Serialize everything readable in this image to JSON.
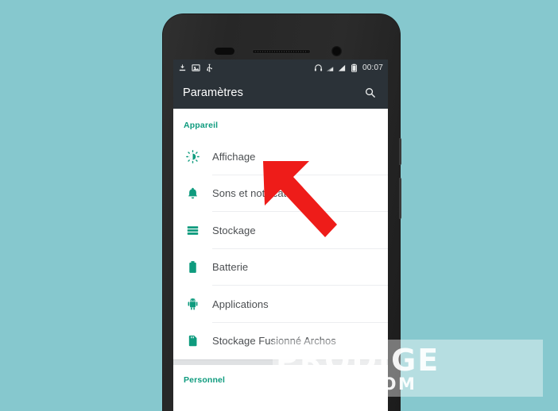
{
  "meta": {
    "background_color": "#86c8ce",
    "accent_teal": "#0e9b7e",
    "arrow_color": "#ee1c19",
    "statusbar_color": "#2b3238"
  },
  "phone": {
    "hardware": {
      "sensor": "proximity-sensor",
      "speaker": "earpiece-speaker",
      "camera": "front-camera",
      "power_button": "power-button",
      "volume_button": "volume-button"
    }
  },
  "statusbar": {
    "left_icons": [
      {
        "name": "download-icon",
        "label": "download"
      },
      {
        "name": "screenshot-icon",
        "label": "screenshot"
      },
      {
        "name": "usb-icon",
        "label": "usb"
      }
    ],
    "right_icons": [
      {
        "name": "headphones-icon",
        "label": "headphones"
      },
      {
        "name": "signal-sim1-icon",
        "label": "signal 1"
      },
      {
        "name": "signal-sim2-icon",
        "label": "signal 2"
      },
      {
        "name": "battery-icon",
        "label": "battery"
      }
    ],
    "time": "00:07"
  },
  "appbar": {
    "title": "Paramètres",
    "search_icon": "search-icon"
  },
  "settings": {
    "sections": [
      {
        "header": "Appareil",
        "items": [
          {
            "label": "Affichage",
            "icon": "brightness-icon"
          },
          {
            "label": "Sons et notifications",
            "icon": "bell-icon"
          },
          {
            "label": "Stockage",
            "icon": "storage-icon"
          },
          {
            "label": "Batterie",
            "icon": "battery-icon"
          },
          {
            "label": "Applications",
            "icon": "android-robot-icon"
          },
          {
            "label": "Stockage Fusionné Archos",
            "icon": "sd-card-icon"
          }
        ]
      },
      {
        "header": "Personnel",
        "items": []
      }
    ]
  },
  "annotation": {
    "arrow": {
      "name": "red-arrow-pointer",
      "points_to": "Affichage",
      "color": "#ee1c19"
    }
  },
  "watermark": {
    "main": "PRODIGE",
    "sub": "MOBILE.COM"
  }
}
